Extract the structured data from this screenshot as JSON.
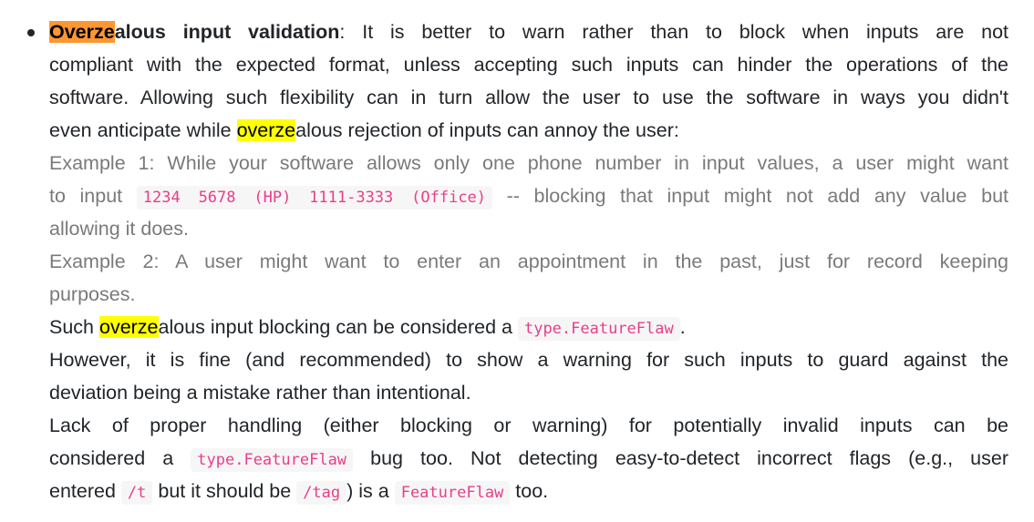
{
  "colors": {
    "text": "#212529",
    "muted": "#7a7a7a",
    "code": "#e83e8c",
    "highlight_current": "#ff9632",
    "highlight_match": "#ffff00"
  },
  "item": {
    "title_hl": "Overze",
    "title_rest": "alous input validation",
    "l1_rest": ": It is better to warn rather than to block when inputs are not",
    "l2": "compliant with the expected format, unless accepting such inputs can hinder the operations of the",
    "l3": "software. Allowing such flexibility can in turn allow the user to use the software in ways you didn't",
    "l4a": "even anticipate while ",
    "l4hl": "overze",
    "l4b": "alous rejection of inputs can annoy the user:",
    "ex1a": "Example 1: While your software allows only one phone number in input values, a user might want",
    "ex1b": "to input ",
    "ex1code": "1234 5678 (HP) 1111-3333 (Office)",
    "ex1c": " -- blocking that input might not add any value but",
    "ex1d": "allowing it does.",
    "ex2a": "Example 2: A user might want to enter an appointment in the past, just for record keeping",
    "ex2b": "purposes.",
    "l10a": "Such ",
    "l10hl": "overze",
    "l10b": "alous input blocking can be considered a ",
    "l10code": "type.FeatureFlaw",
    "l10c": ".",
    "l11": "However, it is fine (and recommended) to show a warning for such inputs to guard against the",
    "l12": "deviation being a mistake rather than intentional.",
    "l13": "Lack of proper handling (either blocking or warning) for potentially invalid inputs can be",
    "l14a": "considered a ",
    "l14code": "type.FeatureFlaw",
    "l14b": " bug too. Not detecting easy-to-detect incorrect flags (e.g., user",
    "l15a": "entered ",
    "l15code1": "/t",
    "l15b": " but it should be ",
    "l15code2": "/tag",
    "l15c": ") is a ",
    "l15code3": "FeatureFlaw",
    "l15d": " too."
  }
}
